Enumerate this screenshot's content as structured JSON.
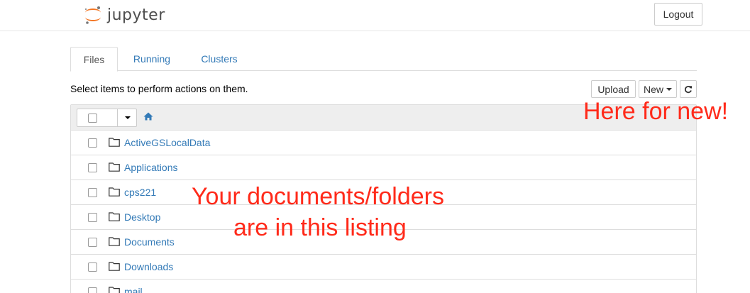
{
  "header": {
    "logo_text": "jupyter",
    "logout_label": "Logout"
  },
  "tabs": [
    {
      "label": "Files",
      "active": true
    },
    {
      "label": "Running",
      "active": false
    },
    {
      "label": "Clusters",
      "active": false
    }
  ],
  "toolbar": {
    "hint": "Select items to perform actions on them.",
    "upload_label": "Upload",
    "new_label": "New",
    "refresh_icon": "refresh-icon"
  },
  "listing": {
    "home_icon": "home-icon",
    "items": [
      {
        "name": "ActiveGSLocalData",
        "type": "folder"
      },
      {
        "name": "Applications",
        "type": "folder"
      },
      {
        "name": "cps221",
        "type": "folder"
      },
      {
        "name": "Desktop",
        "type": "folder"
      },
      {
        "name": "Documents",
        "type": "folder"
      },
      {
        "name": "Downloads",
        "type": "folder"
      },
      {
        "name": "mail",
        "type": "folder"
      }
    ]
  },
  "annotations": {
    "new_note": "Here for new!",
    "listing_note_line1": "Your documents/folders",
    "listing_note_line2": "are in this listing"
  },
  "colors": {
    "link": "#337ab7",
    "annotation": "#ff2a1a",
    "logo_orange": "#f37726"
  }
}
